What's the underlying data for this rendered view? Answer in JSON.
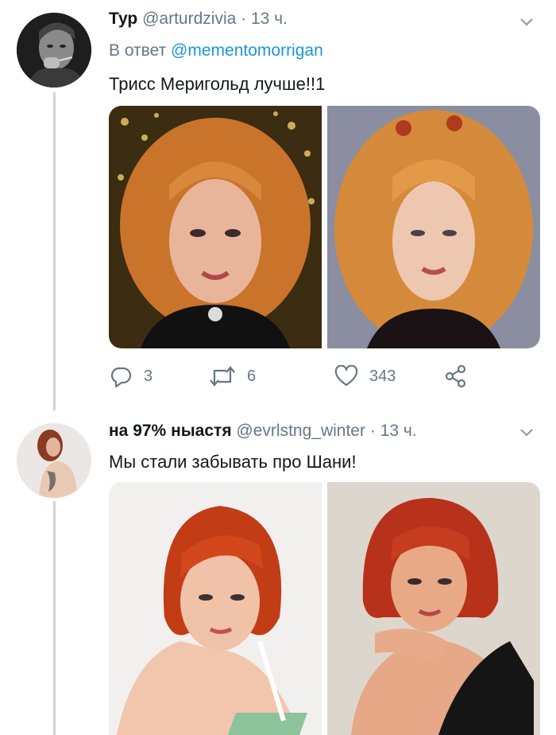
{
  "colors": {
    "accent": "#1b95e0",
    "muted": "#657786",
    "text": "#14171a",
    "thread_line": "#cdd6dd"
  },
  "tweets": [
    {
      "display_name": "Тур",
      "handle": "@arturdzivia",
      "dot": "·",
      "time": "13 ч.",
      "reply_prefix": "В ответ",
      "reply_handle": "@mementomorrigan",
      "text": "Трисс Меригольд лучше!!1",
      "avatar_icon": "avatar-photo-bw",
      "media_icons": [
        "photo-red-curly-hair-left",
        "photo-red-curly-hair-right"
      ],
      "actions": {
        "reply_icon": "reply-icon",
        "reply_count": "3",
        "retweet_icon": "retweet-icon",
        "retweet_count": "6",
        "like_icon": "heart-icon",
        "like_count": "343",
        "share_icon": "share-icon"
      },
      "menu_icon": "chevron-down-icon"
    },
    {
      "display_name": "на 97% ныастя",
      "handle": "@evrlstng_winter",
      "dot": "·",
      "time": "13 ч.",
      "text": "Мы стали забывать про Шани!",
      "avatar_icon": "avatar-photo-red-hair",
      "media_icons": [
        "photo-red-bob-left",
        "photo-red-bob-right"
      ],
      "menu_icon": "chevron-down-icon"
    }
  ]
}
